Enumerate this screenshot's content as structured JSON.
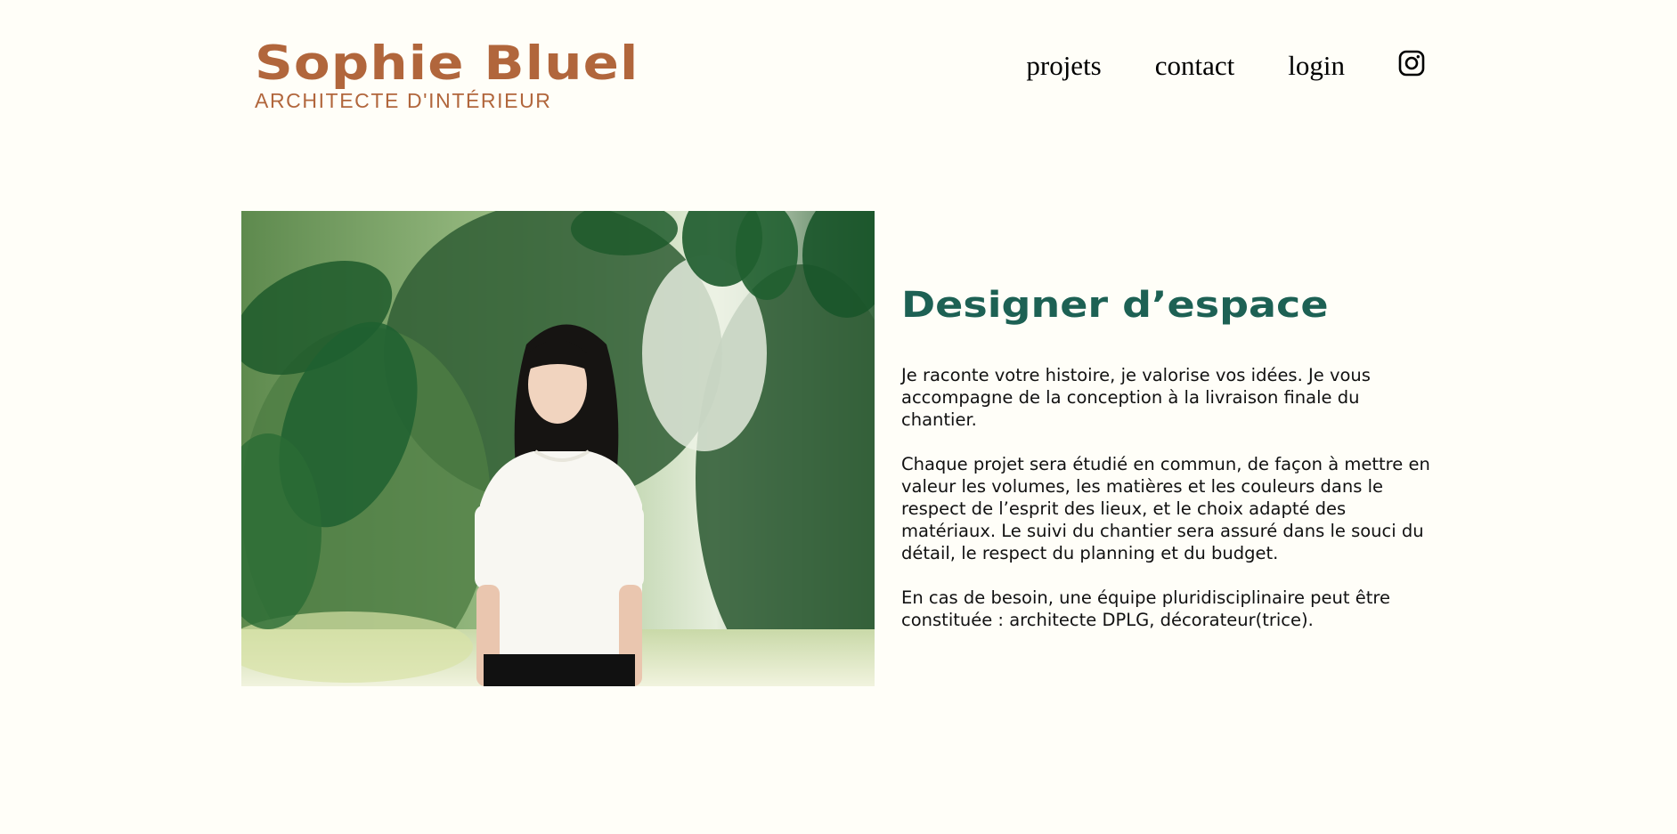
{
  "header": {
    "brand_name": "Sophie Bluel",
    "brand_subtitle": "ARCHITECTE D'INTÉRIEUR",
    "nav": {
      "projects": "projets",
      "contact": "contact",
      "login": "login",
      "instagram_icon": "instagram-icon"
    }
  },
  "intro": {
    "title": "Designer d’espace",
    "paragraphs": [
      "Je raconte votre histoire, je valorise vos idées. Je vous accompagne de la conception à la livraison finale du chantier.",
      "Chaque projet sera étudié en commun, de façon à mettre en valeur les volumes, les matières et les couleurs dans le respect de l’esprit des lieux, et le choix adapté des matériaux. Le suivi du chantier sera assuré dans le souci du détail, le respect du planning et du budget.",
      "En cas de besoin, une équipe pluridisciplinaire peut être constituée : architecte DPLG, décorateur(trice)."
    ]
  },
  "colors": {
    "background": "#FFFEF8",
    "brand": "#B1663C",
    "title": "#1D6154",
    "text": "#111111"
  }
}
